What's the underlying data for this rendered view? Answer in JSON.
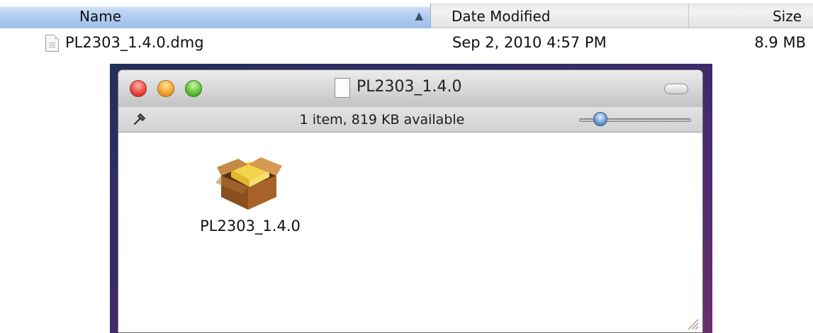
{
  "list": {
    "columns": {
      "name": "Name",
      "date": "Date Modified",
      "size": "Size"
    },
    "sort_indicator": "▲",
    "row": {
      "name": "PL2303_1.4.0.dmg",
      "date": "Sep 2, 2010 4:57 PM",
      "size": "8.9 MB",
      "icon": "document-icon"
    }
  },
  "window": {
    "title": "PL2303_1.4.0",
    "status": "1 item, 819 KB available",
    "icon_size_slider": 0.15,
    "items": [
      {
        "label": "PL2303_1.4.0",
        "icon": "package-icon"
      }
    ]
  },
  "colors": {
    "list_header_selected": "#b6cff0",
    "window_background": "#ffffff",
    "desktop_backdrop": "#3b2a6a"
  }
}
